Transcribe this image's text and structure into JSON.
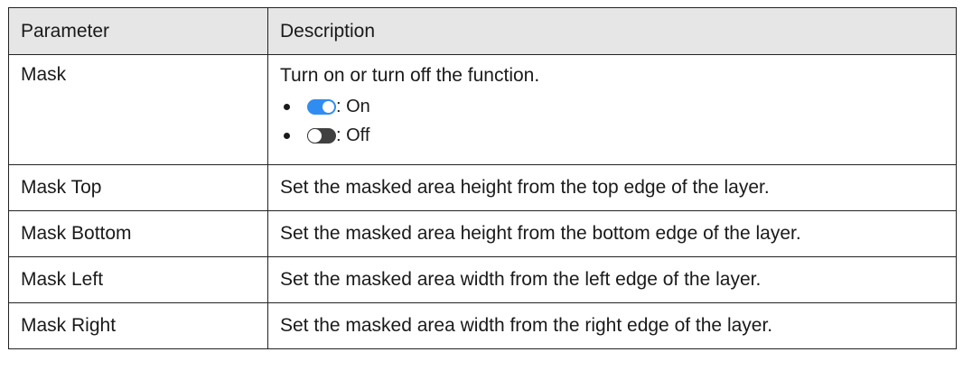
{
  "table": {
    "headers": {
      "parameter": "Parameter",
      "description": "Description"
    },
    "mask": {
      "name": "Mask",
      "description": "Turn on or turn off the function.",
      "options": [
        {
          "icon": "toggle-on-icon",
          "label": ": On"
        },
        {
          "icon": "toggle-off-icon",
          "label": ": Off"
        }
      ]
    },
    "rows": [
      {
        "parameter": "Mask Top",
        "description": "Set the masked area height from the top edge of the layer."
      },
      {
        "parameter": "Mask Bottom",
        "description": "Set the masked area height from the bottom edge of the layer."
      },
      {
        "parameter": "Mask Left",
        "description": "Set the masked area width from the left edge of the layer."
      },
      {
        "parameter": "Mask Right",
        "description": "Set the masked area width from the right edge of the layer."
      }
    ]
  },
  "colors": {
    "header_bg": "#e6e6e6",
    "toggle_on": "#2f8df2",
    "toggle_off": "#404040",
    "border": "#222222"
  }
}
